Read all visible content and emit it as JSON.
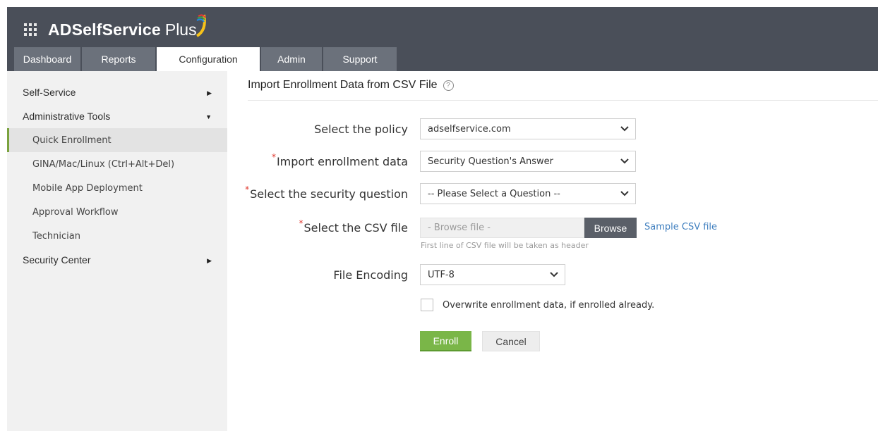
{
  "app": {
    "name": "ADSelfService",
    "name_suffix": "Plus"
  },
  "tabs": [
    {
      "label": "Dashboard",
      "active": false
    },
    {
      "label": "Reports",
      "active": false
    },
    {
      "label": "Configuration",
      "active": true
    },
    {
      "label": "Admin",
      "active": false
    },
    {
      "label": "Support",
      "active": false
    }
  ],
  "sidebar": {
    "sections": [
      {
        "label": "Self-Service",
        "expanded": false
      },
      {
        "label": "Administrative Tools",
        "expanded": true,
        "items": [
          {
            "label": "Quick Enrollment",
            "active": true
          },
          {
            "label": "GINA/Mac/Linux (Ctrl+Alt+Del)",
            "active": false
          },
          {
            "label": "Mobile App Deployment",
            "active": false
          },
          {
            "label": "Approval Workflow",
            "active": false
          },
          {
            "label": "Technician",
            "active": false
          }
        ]
      },
      {
        "label": "Security Center",
        "expanded": false
      }
    ]
  },
  "main": {
    "title": "Import Enrollment Data from CSV File",
    "help_glyph": "?",
    "form": {
      "policy": {
        "label": "Select the policy",
        "value": "adselfservice.com"
      },
      "import_data": {
        "label": "Import enrollment data",
        "required_mark": "*",
        "value": "Security Question's Answer"
      },
      "security_question": {
        "label": "Select the security question",
        "required_mark": "*",
        "value": "-- Please Select a Question --"
      },
      "csv_file": {
        "label": "Select the CSV file",
        "required_mark": "*",
        "placeholder": "- Browse file -",
        "browse_label": "Browse",
        "sample_link": "Sample CSV file",
        "hint": "First line of CSV file will be taken as header"
      },
      "encoding": {
        "label": "File Encoding",
        "value": "UTF-8"
      },
      "overwrite": {
        "label": "Overwrite enrollment data, if enrolled already.",
        "checked": false
      },
      "enroll_label": "Enroll",
      "cancel_label": "Cancel"
    }
  },
  "colors": {
    "header": "#4a4f59",
    "tab": "#6b717b",
    "accent_green": "#7ab648",
    "link": "#3f7fbf",
    "required": "#e0362c"
  }
}
